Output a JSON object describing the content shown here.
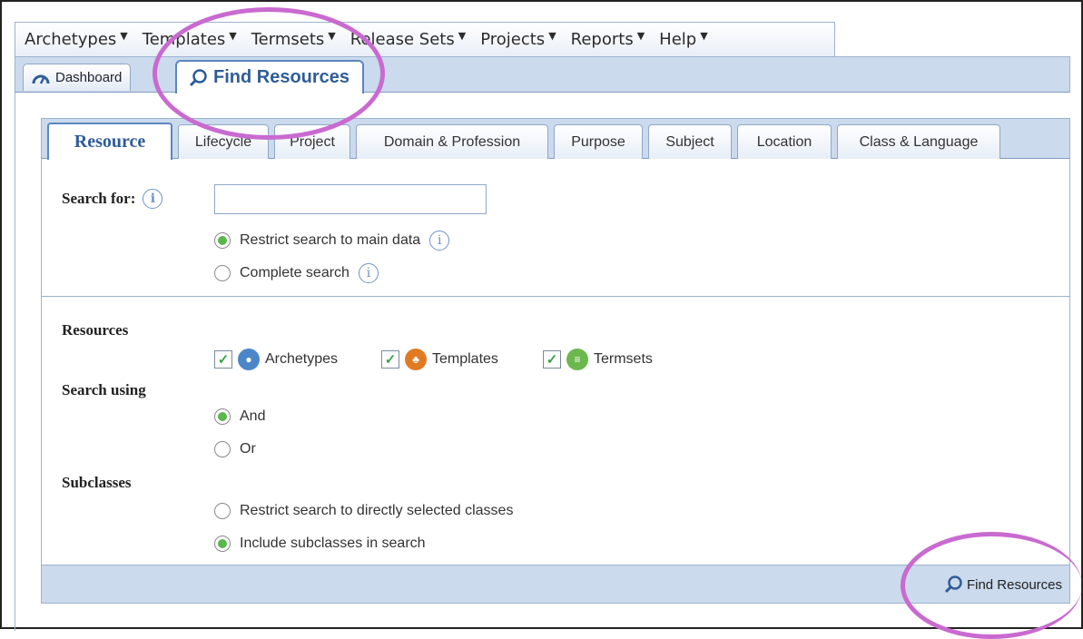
{
  "menubar": {
    "items": [
      {
        "label": "Archetypes"
      },
      {
        "label": "Templates"
      },
      {
        "label": "Termsets"
      },
      {
        "label": "Release Sets"
      },
      {
        "label": "Projects"
      },
      {
        "label": "Reports"
      },
      {
        "label": "Help"
      }
    ]
  },
  "main_tabs": {
    "dashboard": "Dashboard",
    "find_resources": "Find Resources"
  },
  "sub_tabs": [
    {
      "label": "Resource",
      "active": true
    },
    {
      "label": "Lifecycle"
    },
    {
      "label": "Project"
    },
    {
      "label": "Domain & Profession"
    },
    {
      "label": "Purpose"
    },
    {
      "label": "Subject"
    },
    {
      "label": "Location"
    },
    {
      "label": "Class & Language"
    }
  ],
  "search": {
    "label": "Search for:",
    "value": "",
    "placeholder": "",
    "options": [
      {
        "label": "Restrict search to main data",
        "selected": true
      },
      {
        "label": "Complete search",
        "selected": false
      }
    ]
  },
  "resources": {
    "label": "Resources",
    "items": [
      {
        "label": "Archetypes",
        "checked": true,
        "icon": "archetype-icon",
        "color": "#4a86c8"
      },
      {
        "label": "Templates",
        "checked": true,
        "icon": "template-icon",
        "color": "#e07b24"
      },
      {
        "label": "Termsets",
        "checked": true,
        "icon": "termset-icon",
        "color": "#6bb84e"
      }
    ]
  },
  "search_using": {
    "label": "Search using",
    "options": [
      {
        "label": "And",
        "selected": true
      },
      {
        "label": "Or",
        "selected": false
      }
    ]
  },
  "subclasses": {
    "label": "Subclasses",
    "options": [
      {
        "label": "Restrict search to directly selected classes",
        "selected": false
      },
      {
        "label": "Include subclasses in search",
        "selected": true
      }
    ]
  },
  "footer": {
    "find_button": "Find Resources"
  },
  "colors": {
    "accent": "#2f5d97",
    "tab_bar": "#cbdaed",
    "highlight": "#c96ad0",
    "radio_on": "#58b84a"
  }
}
